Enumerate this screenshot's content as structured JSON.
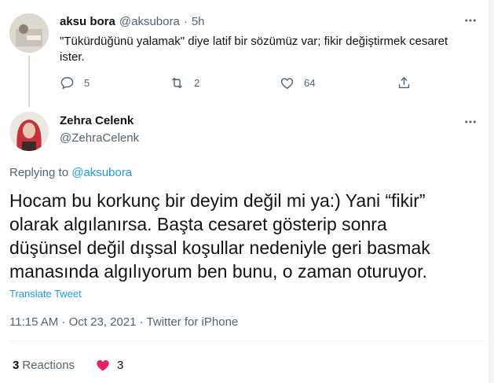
{
  "parent_tweet": {
    "name": "aksu bora",
    "handle": "@aksubora",
    "separator": "·",
    "time": "5h",
    "text_line1": "\"Tükürdüğünü yalamak\" diye latif bir sözümüz var; fikir değiştirmek cesaret",
    "text_line2": "ister.",
    "more_icon": "more-horizontal-icon",
    "reply_count": "5",
    "retweet_count": "2",
    "like_count": "64"
  },
  "reply_tweet": {
    "name": "Zehra Celenk",
    "handle": "@ZehraCelenk",
    "replying_prefix": "Replying to",
    "replying_handle": "@aksubora",
    "text_lines": [
      "Hocam bu korkunç bir deyim değil mi ya:) Yani “fikir”",
      "olarak algılanırsa. Başta cesaret gösterip sonra",
      "düşünsel değil dışsal koşullar nedeniyle geri basmak",
      "manasında algılıyorum ben bunu, o zaman oturuyor."
    ],
    "translate_label": "Translate Tweet",
    "timestamp": "11:15 AM · Oct 23, 2021 · Twitter for iPhone",
    "reactions_count": "3",
    "reactions_label": "Reactions",
    "heart_count": "3"
  },
  "colors": {
    "accent": "#1d9bf0",
    "muted": "#536471",
    "heart": "#e0245e"
  }
}
